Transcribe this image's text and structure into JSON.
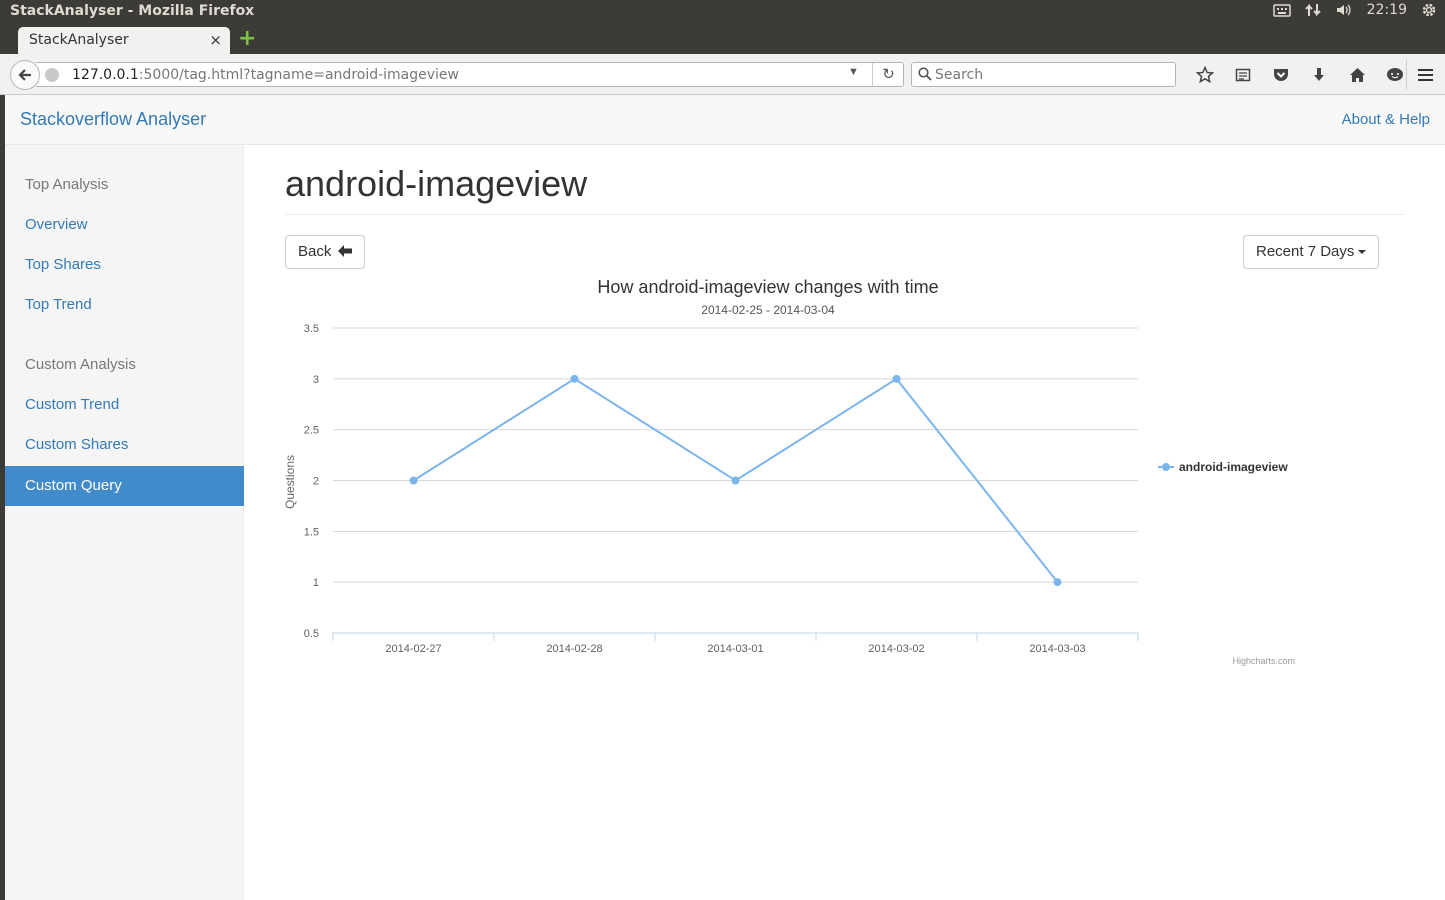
{
  "os": {
    "window_title": "StackAnalyser - Mozilla Firefox",
    "clock": "22:19",
    "icons": [
      "keyboard-icon",
      "network-icon",
      "volume-icon",
      "settings-icon"
    ]
  },
  "browser": {
    "tab_label": "StackAnalyser",
    "tab_close": "×",
    "new_tab": "+",
    "url_host": "127.0.0.1",
    "url_rest": ":5000/tag.html?tagname=android-imageview",
    "search_placeholder": "Search",
    "toolbar_icons": [
      "bookmark-star-icon",
      "reading-list-icon",
      "pocket-icon",
      "download-icon",
      "home-icon",
      "chat-icon"
    ]
  },
  "header": {
    "brand": "Stackoverflow Analyser",
    "about": "About & Help"
  },
  "sidebar": {
    "items": [
      {
        "label": "Top Analysis",
        "kind": "header"
      },
      {
        "label": "Overview",
        "kind": "link"
      },
      {
        "label": "Top Shares",
        "kind": "link"
      },
      {
        "label": "Top Trend",
        "kind": "link"
      },
      {
        "label": "Custom Analysis",
        "kind": "header"
      },
      {
        "label": "Custom Trend",
        "kind": "link"
      },
      {
        "label": "Custom Shares",
        "kind": "link"
      },
      {
        "label": "Custom Query",
        "kind": "active"
      }
    ]
  },
  "main": {
    "title": "android-imageview",
    "back_label": "Back",
    "range_label": "Recent 7 Days"
  },
  "chart_data": {
    "type": "line",
    "title": "How android-imageview changes with time",
    "subtitle": "2014-02-25 - 2014-03-04",
    "ylabel": "Questions",
    "xlabel": "",
    "categories": [
      "2014-02-27",
      "2014-02-28",
      "2014-03-01",
      "2014-03-02",
      "2014-03-03"
    ],
    "series": [
      {
        "name": "android-imageview",
        "values": [
          2,
          3,
          2,
          3,
          1
        ],
        "color": "#7cb5ec"
      }
    ],
    "ylim": [
      0.5,
      3.5
    ],
    "yticks": [
      "0.5",
      "1",
      "1.5",
      "2",
      "2.5",
      "3",
      "3.5"
    ],
    "grid": true,
    "legend_position": "right",
    "credits": "Highcharts.com"
  }
}
